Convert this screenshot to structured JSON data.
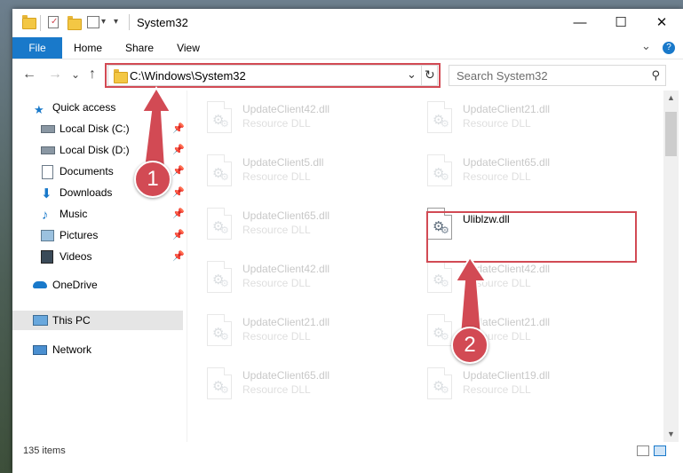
{
  "window": {
    "title": "System32",
    "controls": {
      "minimize": "—",
      "maximize": "☐",
      "close": "✕"
    }
  },
  "ribbon": {
    "tabs": [
      "File",
      "Home",
      "Share",
      "View"
    ],
    "expand_glyph": "⌄",
    "help_glyph": "?"
  },
  "address": {
    "path": "C:\\Windows\\System32",
    "dropdown_glyph": "⌄",
    "refresh_glyph": "↻"
  },
  "search": {
    "placeholder": "Search System32",
    "icon_glyph": "⚲"
  },
  "nav_glyphs": {
    "back": "←",
    "forward": "→",
    "recent": "⌄",
    "up": "↑"
  },
  "sidebar": {
    "items": [
      {
        "label": "Quick access",
        "icon": "star-icon",
        "pinned": false
      },
      {
        "label": "Local Disk (C:)",
        "icon": "drive-icon",
        "pinned": true
      },
      {
        "label": "Local Disk (D:)",
        "icon": "drive-icon",
        "pinned": true
      },
      {
        "label": "Documents",
        "icon": "documents-icon",
        "pinned": true
      },
      {
        "label": "Downloads",
        "icon": "downloads-icon",
        "pinned": true
      },
      {
        "label": "Music",
        "icon": "music-icon",
        "pinned": true
      },
      {
        "label": "Pictures",
        "icon": "pictures-icon",
        "pinned": true
      },
      {
        "label": "Videos",
        "icon": "videos-icon",
        "pinned": true
      },
      {
        "label": "OneDrive",
        "icon": "onedrive-icon",
        "pinned": false
      },
      {
        "label": "This PC",
        "icon": "this-pc-icon",
        "pinned": false,
        "selected": true
      },
      {
        "label": "Network",
        "icon": "network-icon",
        "pinned": false
      }
    ]
  },
  "files": [
    {
      "name": "UpdateClient42.dll",
      "type": "Resource DLL",
      "faded": true
    },
    {
      "name": "UpdateClient21.dll",
      "type": "Resource DLL",
      "faded": true
    },
    {
      "name": "UpdateClient5.dll",
      "type": "Resource DLL",
      "faded": true
    },
    {
      "name": "UpdateClient65.dll",
      "type": "Resource DLL",
      "faded": true
    },
    {
      "name": "UpdateClient65.dll",
      "type": "Resource DLL",
      "faded": true
    },
    {
      "name": "Uliblzw.dll",
      "type": "",
      "faded": false
    },
    {
      "name": "UpdateClient42.dll",
      "type": "Resource DLL",
      "faded": true
    },
    {
      "name": "UpdateClient42.dll",
      "type": "Resource DLL",
      "faded": true
    },
    {
      "name": "UpdateClient21.dll",
      "type": "Resource DLL",
      "faded": true
    },
    {
      "name": "UpdateClient21.dll",
      "type": "Resource DLL",
      "faded": true
    },
    {
      "name": "UpdateClient65.dll",
      "type": "Resource DLL",
      "faded": true
    },
    {
      "name": "UpdateClient19.dll",
      "type": "Resource DLL",
      "faded": true
    }
  ],
  "status": {
    "item_count": "135 items"
  },
  "callouts": {
    "step1": "1",
    "step2": "2"
  },
  "colors": {
    "accent": "#1979ca",
    "highlight": "#d24a54",
    "selected_bg": "#e5e5e5"
  }
}
